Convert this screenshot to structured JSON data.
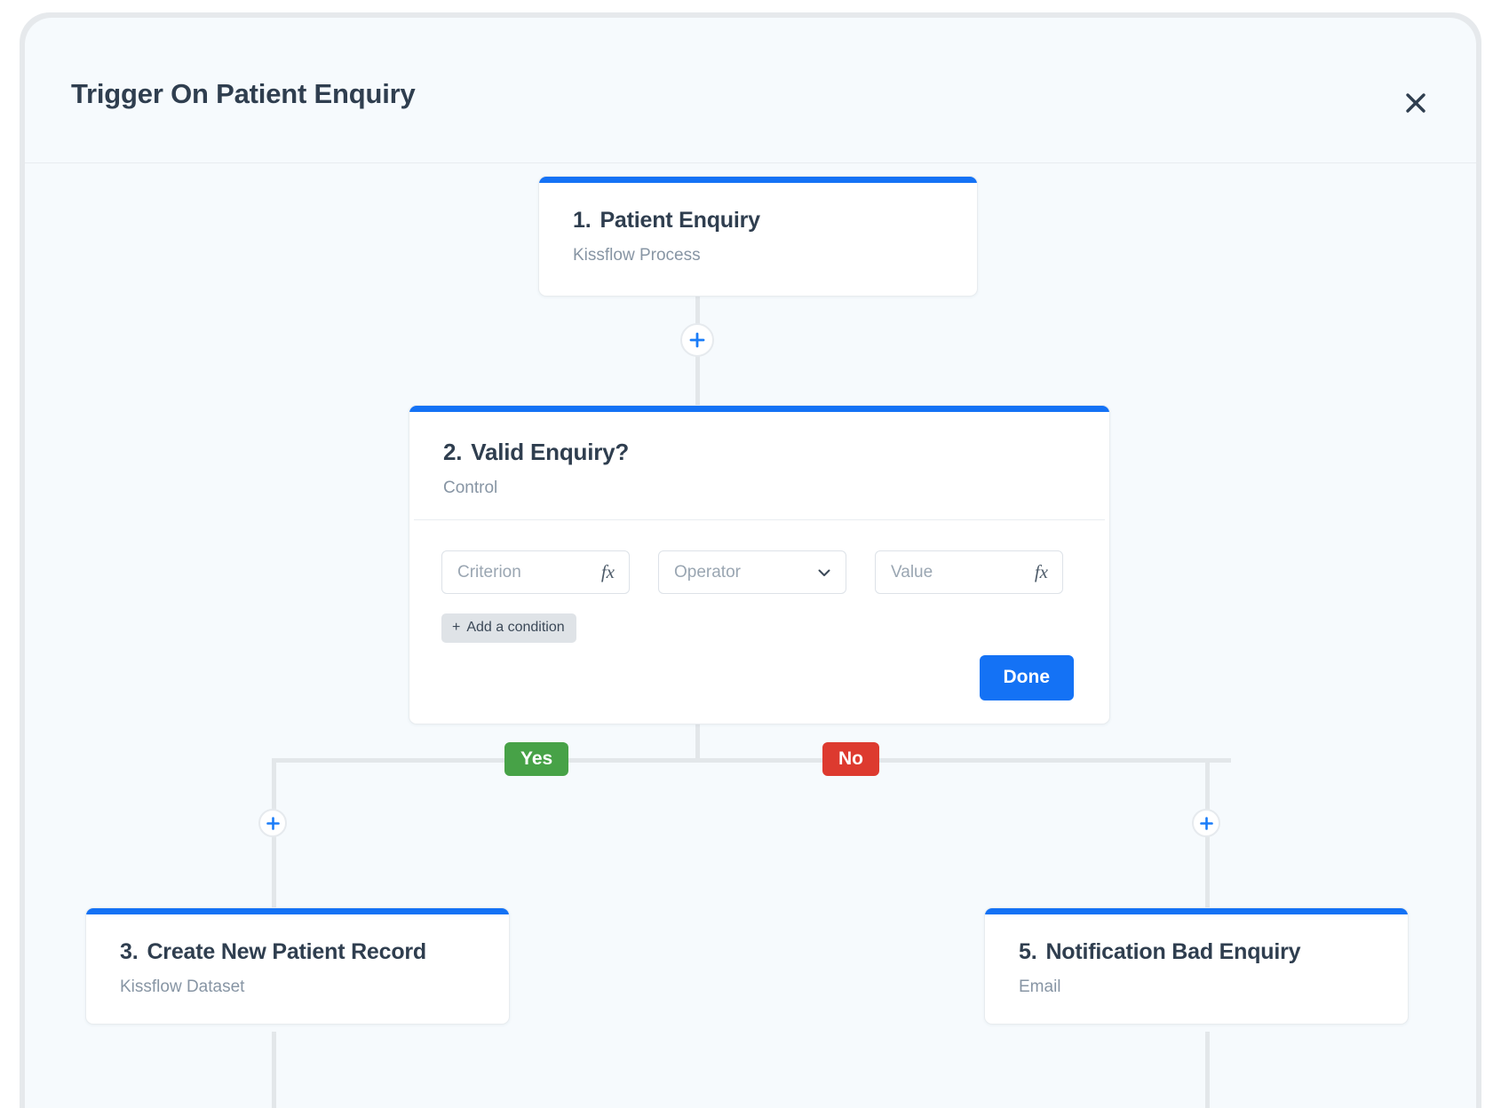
{
  "header": {
    "title": "Trigger On Patient Enquiry",
    "close_icon": "close-icon"
  },
  "theme": {
    "accent_blue": "#1472f5",
    "yes_green": "#47a247",
    "no_red": "#dd3a2f",
    "panel_bg": "#f6fafd",
    "line_gray": "#e3e7ea",
    "title_color": "#2f3e4f",
    "subtitle_color": "#8795a4"
  },
  "nodes": [
    {
      "number": "1.",
      "title": "Patient Enquiry",
      "subtitle": "Kissflow Process"
    },
    {
      "number": "2.",
      "title": "Valid Enquiry?",
      "subtitle": "Control"
    },
    {
      "number": "3.",
      "title": "Create New Patient Record",
      "subtitle": "Kissflow Dataset"
    },
    {
      "number": "5.",
      "title": "Notification Bad Enquiry",
      "subtitle": "Email"
    }
  ],
  "condition_form": {
    "criterion": {
      "placeholder": "Criterion",
      "value": "",
      "formula_icon": "fx"
    },
    "operator": {
      "placeholder": "Operator",
      "value": "",
      "chevron_icon": "chevron-down-icon"
    },
    "value_field": {
      "placeholder": "Value",
      "value": "",
      "formula_icon": "fx"
    },
    "add_condition_label": "Add a condition",
    "add_condition_plus": "+",
    "done_label": "Done"
  },
  "branches": {
    "yes_label": "Yes",
    "no_label": "No"
  },
  "connectors": {
    "add_step_icon": "plus-icon"
  }
}
